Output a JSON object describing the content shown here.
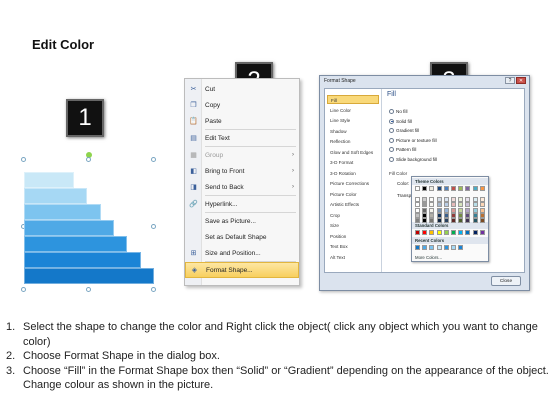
{
  "title": "Edit Color",
  "badges": [
    "1",
    "2",
    "3"
  ],
  "stairs": {
    "colors": [
      "#c9e8f7",
      "#a6d8f4",
      "#7dc4ef",
      "#4fa9e6",
      "#2d94de",
      "#1b84d6",
      "#1478c9"
    ],
    "handle_color": "#7aa6c2",
    "rotate_color": "#8ed44d"
  },
  "context_menu": {
    "items": [
      {
        "icon": "scissors-icon",
        "glyph": "✂",
        "label": "Cut",
        "arrow": "",
        "disabled": false,
        "highlight": false
      },
      {
        "icon": "copy-icon",
        "glyph": "❐",
        "label": "Copy",
        "arrow": "",
        "disabled": false,
        "highlight": false
      },
      {
        "icon": "paste-icon",
        "glyph": "📋",
        "label": "Paste",
        "arrow": "",
        "disabled": false,
        "highlight": false
      },
      {
        "icon": "edit-text-icon",
        "glyph": "▤",
        "label": "Edit Text",
        "arrow": "",
        "disabled": false,
        "highlight": false
      },
      {
        "icon": "group-icon",
        "glyph": "▦",
        "label": "Group",
        "arrow": "›",
        "disabled": true,
        "highlight": false
      },
      {
        "icon": "bring-to-front-icon",
        "glyph": "◧",
        "label": "Bring to Front",
        "arrow": "›",
        "disabled": false,
        "highlight": false
      },
      {
        "icon": "send-to-back-icon",
        "glyph": "◨",
        "label": "Send to Back",
        "arrow": "›",
        "disabled": false,
        "highlight": false
      },
      {
        "icon": "hyperlink-icon",
        "glyph": "🔗",
        "label": "Hyperlink...",
        "arrow": "",
        "disabled": false,
        "highlight": false
      },
      {
        "icon": "",
        "glyph": "",
        "label": "Save as Picture...",
        "arrow": "",
        "disabled": false,
        "highlight": false
      },
      {
        "icon": "",
        "glyph": "",
        "label": "Set as Default Shape",
        "arrow": "",
        "disabled": false,
        "highlight": false
      },
      {
        "icon": "size-position-icon",
        "glyph": "⊞",
        "label": "Size and Position...",
        "arrow": "",
        "disabled": false,
        "highlight": false
      },
      {
        "icon": "format-shape-icon",
        "glyph": "◈",
        "label": "Format Shape...",
        "arrow": "",
        "disabled": false,
        "highlight": true
      }
    ]
  },
  "dialog": {
    "title": "Format Shape",
    "nav": [
      "Fill",
      "Line Color",
      "Line Style",
      "Shadow",
      "Reflection",
      "Glow and Soft Edges",
      "3-D Format",
      "3-D Rotation",
      "Picture Corrections",
      "Picture Color",
      "Artistic Effects",
      "Crop",
      "Size",
      "Position",
      "Text Box",
      "Alt Text"
    ],
    "pane_title": "Fill",
    "options": [
      "No fill",
      "Solid fill",
      "Gradient fill",
      "Picture or texture fill",
      "Pattern fill",
      "Slide background fill"
    ],
    "selected_option": 1,
    "fill_color_label": "Fill Color",
    "color_label": "Color:",
    "transparency_label": "Transpa",
    "close_label": "Close",
    "palette": {
      "theme_label": "Theme Colors",
      "standard_label": "Standard Colors",
      "recent_label": "Recent Colors",
      "more_label": "More Colors...",
      "theme_top": [
        "#ffffff",
        "#000000",
        "#eeece1",
        "#1f497d",
        "#4f81bd",
        "#c0504d",
        "#9bbb59",
        "#8064a2",
        "#4bacc6",
        "#f79646"
      ],
      "standard": [
        "#c00000",
        "#ff0000",
        "#ffc000",
        "#ffff00",
        "#92d050",
        "#00b050",
        "#00b0f0",
        "#0070c0",
        "#002060",
        "#7030a0"
      ],
      "recent": [
        "#1478c9",
        "#4fa9e6",
        "#7dc4ef",
        "#c9e8f7",
        "#2d94de",
        "#a6d8f4",
        "#1b84d6"
      ]
    }
  },
  "instructions": [
    {
      "num": "1.",
      "text": "Select the shape to change the color and Right click the object( click any object which you want to change color)"
    },
    {
      "num": "2.",
      "text": "Choose Format Shape in the dialog box."
    },
    {
      "num": "3.",
      "text": "Choose “Fill” in the Format Shape box then “Solid” or “Gradient” depending on the appearance of the object. Change colour as shown in the picture."
    }
  ]
}
